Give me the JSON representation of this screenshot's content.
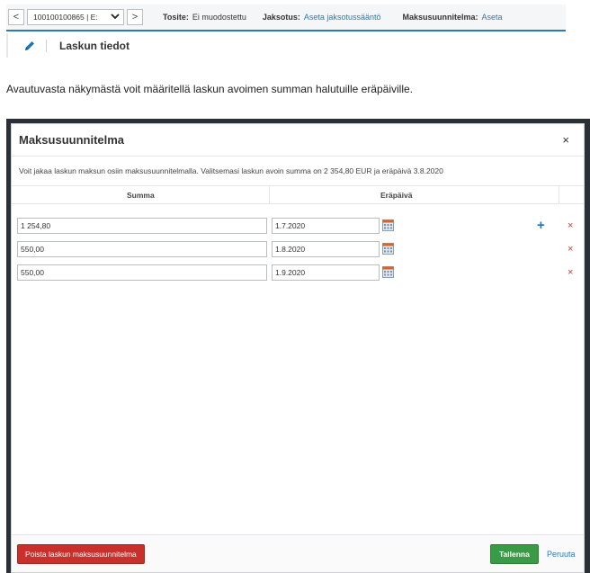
{
  "header": {
    "prev_symbol": "<",
    "next_symbol": ">",
    "document_value": "100100100865 | E:",
    "tosite_label": "Tosite:",
    "tosite_value": "Ei muodostettu",
    "jaksotus_label": "Jaksotus:",
    "jaksotus_link": "Aseta jaksotussääntö",
    "maksusuunnitelma_label": "Maksusuunnitelma:",
    "maksusuunnitelma_link": "Aseta"
  },
  "subheader": {
    "title": "Laskun tiedot"
  },
  "intro_text": "Avautuvasta näkymästä voit määritellä laskun avoimen summan halutuille eräpäiville.",
  "modal": {
    "title": "Maksusuunnitelma",
    "close_symbol": "×",
    "description": "Voit jakaa laskun maksun osiin maksusuunnitelmalla. Valitsemasi laskun avoin summa on 2 354,80 EUR ja eräpäivä 3.8.2020",
    "columns": {
      "amount": "Summa",
      "due_date": "Eräpäivä"
    },
    "rows": [
      {
        "amount": "1 254,80",
        "due_date": "1.7.2020",
        "has_add": true
      },
      {
        "amount": "550,00",
        "due_date": "1.8.2020",
        "has_add": false
      },
      {
        "amount": "550,00",
        "due_date": "1.9.2020",
        "has_add": false
      }
    ],
    "add_symbol": "+",
    "delete_symbol": "×",
    "remove_plan_label": "Poista laskun maksusuunnitelma",
    "save_label": "Tallenna",
    "cancel_label": "Peruuta"
  },
  "colors": {
    "accent": "#2a7ab9",
    "danger": "#c9302c",
    "success": "#3a9b46",
    "backdrop": "#2b2f36"
  }
}
